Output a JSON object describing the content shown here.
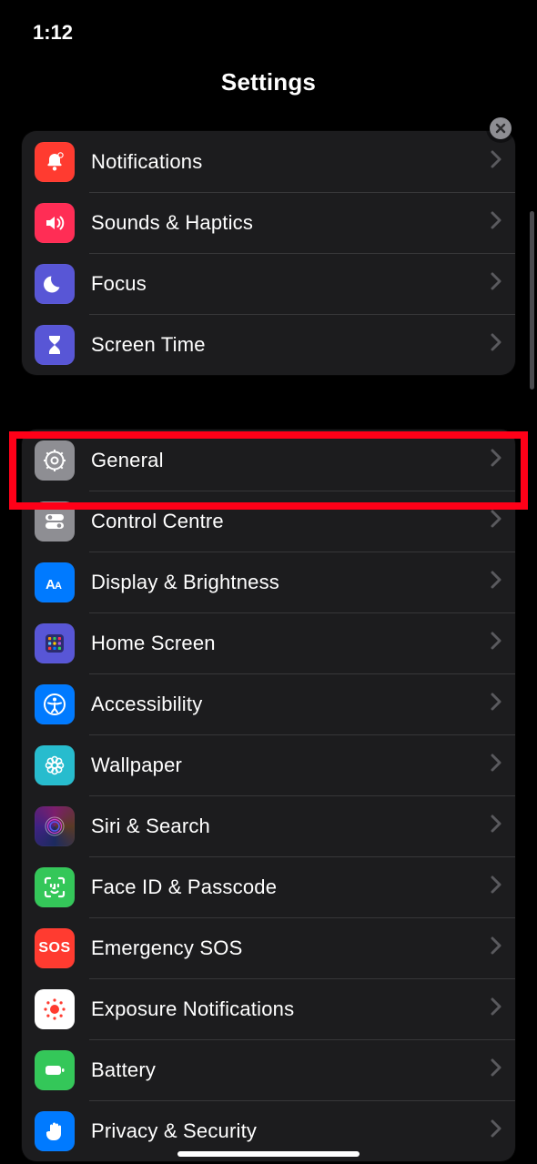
{
  "status": {
    "time": "1:12"
  },
  "title": "Settings",
  "groups": [
    {
      "items": [
        {
          "key": "notifications",
          "label": "Notifications",
          "icon": "bell-badge",
          "bg": "bg-red"
        },
        {
          "key": "sounds",
          "label": "Sounds & Haptics",
          "icon": "speaker",
          "bg": "bg-pink"
        },
        {
          "key": "focus",
          "label": "Focus",
          "icon": "moon",
          "bg": "bg-indigo"
        },
        {
          "key": "screentime",
          "label": "Screen Time",
          "icon": "hourglass",
          "bg": "bg-indigo"
        }
      ]
    },
    {
      "items": [
        {
          "key": "general",
          "label": "General",
          "icon": "gear",
          "bg": "bg-gray"
        },
        {
          "key": "control",
          "label": "Control Centre",
          "icon": "switches",
          "bg": "bg-gray"
        },
        {
          "key": "display",
          "label": "Display & Brightness",
          "icon": "text-size",
          "bg": "bg-blue"
        },
        {
          "key": "home",
          "label": "Home Screen",
          "icon": "app-grid",
          "bg": "bg-indigo"
        },
        {
          "key": "accessibility",
          "label": "Accessibility",
          "icon": "accessibility",
          "bg": "bg-blue"
        },
        {
          "key": "wallpaper",
          "label": "Wallpaper",
          "icon": "flower",
          "bg": "bg-teal"
        },
        {
          "key": "siri",
          "label": "Siri & Search",
          "icon": "siri",
          "bg": "bg-siri"
        },
        {
          "key": "faceid",
          "label": "Face ID & Passcode",
          "icon": "faceid",
          "bg": "bg-green"
        },
        {
          "key": "sos",
          "label": "Emergency SOS",
          "icon": "sos",
          "bg": "bg-red",
          "text": "SOS"
        },
        {
          "key": "exposure",
          "label": "Exposure Notifications",
          "icon": "exposure",
          "bg": "bg-white"
        },
        {
          "key": "battery",
          "label": "Battery",
          "icon": "battery",
          "bg": "bg-green"
        },
        {
          "key": "privacy",
          "label": "Privacy & Security",
          "icon": "hand",
          "bg": "bg-blue"
        }
      ]
    }
  ]
}
